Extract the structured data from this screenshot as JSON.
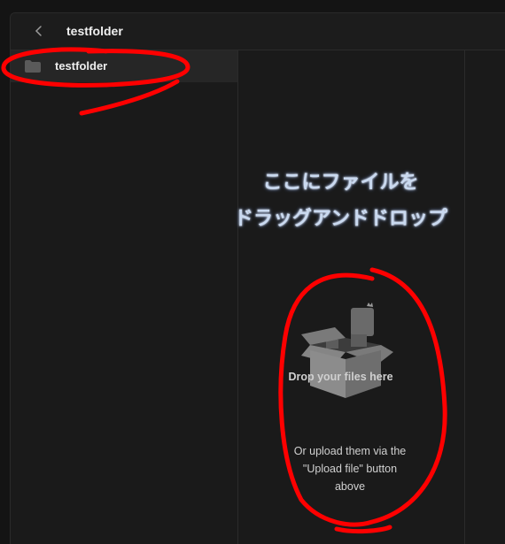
{
  "header": {
    "title": "testfolder",
    "back_icon": "chevron-left-icon"
  },
  "sidebar": {
    "items": [
      {
        "label": "testfolder",
        "icon": "folder-icon"
      }
    ]
  },
  "dropzone": {
    "heading_line1": "ここにファイルを",
    "heading_line2": "ドラッグアンドドロップ",
    "title": "Drop your files here",
    "subtitle_line1": "Or upload them via the",
    "subtitle_line2": "\"Upload file\" button",
    "subtitle_line3": "above",
    "illustration_icon": "open-box-icon"
  },
  "colors": {
    "annotation": "#ff0000",
    "heading": "#c9d9f0"
  }
}
